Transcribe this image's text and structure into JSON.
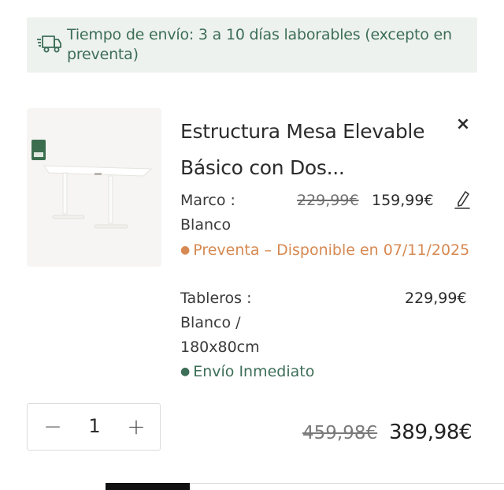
{
  "shipping": {
    "text": "Tiempo de envío: 3 a 10 días laborables (excepto en preventa)",
    "icon": "delivery-truck-icon",
    "color": "#3d6e57",
    "background": "#eef2ef"
  },
  "product": {
    "title": "Estructura Mesa Elevable Básico con Dos...",
    "image_alt": "white standing desk frame",
    "badge": "FSC",
    "marco": {
      "label": "Marco :",
      "value": "Blanco",
      "old_price": "229,99€",
      "price": "159,99€",
      "status": "Preventa – Disponible en 07/11/2025",
      "status_color": "#d68952"
    },
    "tableros": {
      "label": "Tableros :",
      "value_line1": "Blanco /",
      "value_line2": "180x80cm",
      "price": "229,99€",
      "status": "Envío Inmediato",
      "status_color": "#3d6e57"
    }
  },
  "quantity": {
    "minus": "−",
    "value": "1",
    "plus": "+"
  },
  "totals": {
    "old": "459,98€",
    "current": "389,98€"
  },
  "controls": {
    "close": "×"
  }
}
